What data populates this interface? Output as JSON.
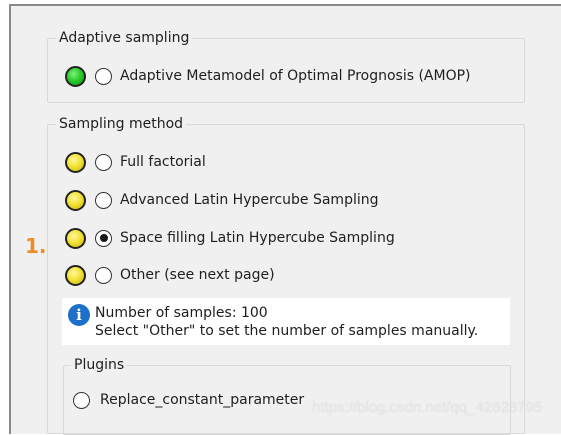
{
  "adaptive_sampling": {
    "title": "Adaptive sampling",
    "options": [
      {
        "label": "Adaptive Metamodel of Optimal Prognosis (AMOP)",
        "status": "green",
        "checked": false
      }
    ]
  },
  "sampling_method": {
    "title": "Sampling method",
    "options": [
      {
        "label": "Full factorial",
        "status": "yellow",
        "checked": false
      },
      {
        "label": "Advanced Latin Hypercube Sampling",
        "status": "yellow",
        "checked": false
      },
      {
        "label": "Space filling Latin Hypercube Sampling",
        "status": "yellow",
        "checked": true
      },
      {
        "label": "Other (see next page)",
        "status": "yellow",
        "checked": false
      }
    ],
    "step_marker": "1.",
    "info": {
      "icon": "info-icon",
      "line1": "Number of samples: 100",
      "line2": "Select \"Other\" to set the number of samples manually."
    }
  },
  "plugins": {
    "title": "Plugins",
    "options": [
      {
        "label": "Replace_constant_parameter",
        "checked": false
      }
    ]
  },
  "watermark": "https://blog.csdn.net/qq_42628795",
  "colors": {
    "status_green": "#2ccc2c",
    "status_yellow": "#f2e338",
    "step_marker": "#f08a24",
    "info_icon": "#1d70c8",
    "panel_background": "#f0f0f0"
  }
}
